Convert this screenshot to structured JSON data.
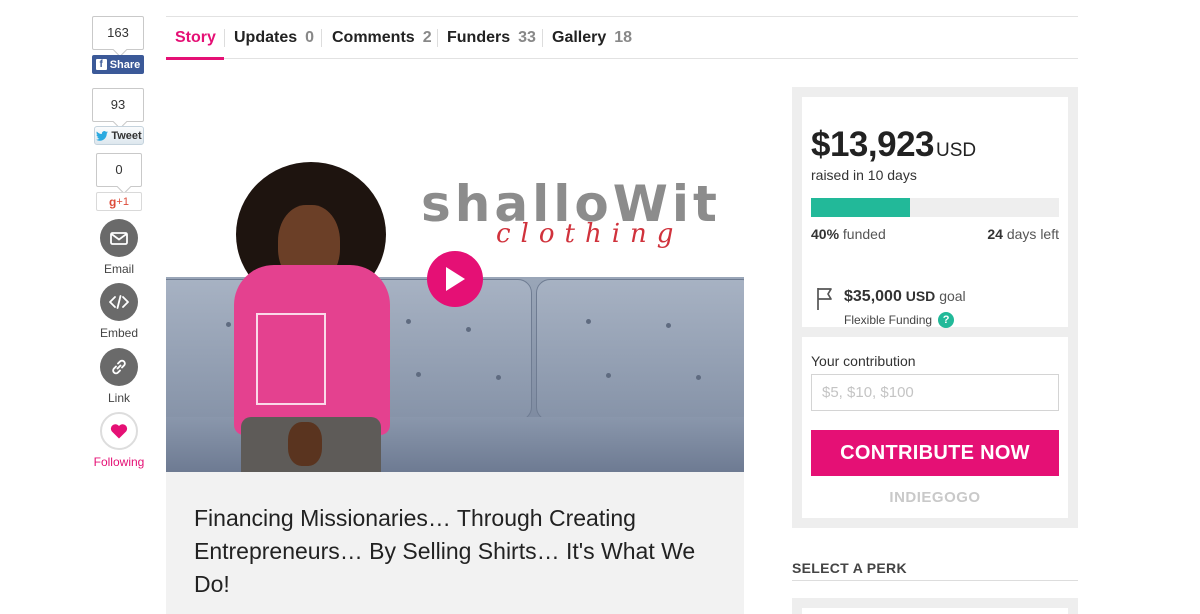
{
  "social": {
    "facebook": {
      "count": "163",
      "label": "Share"
    },
    "twitter": {
      "count": "93",
      "label": "Tweet"
    },
    "google": {
      "count": "0",
      "label": "+1"
    },
    "email": {
      "label": "Email",
      "icon": "envelope-icon"
    },
    "embed": {
      "label": "Embed",
      "icon": "code-icon"
    },
    "link": {
      "label": "Link",
      "icon": "link-icon"
    },
    "follow": {
      "label": "Following",
      "icon": "heart-icon",
      "color": "#e51075"
    }
  },
  "tabs": [
    {
      "label": "Story",
      "count": ""
    },
    {
      "label": "Updates",
      "count": "0"
    },
    {
      "label": "Comments",
      "count": "2"
    },
    {
      "label": "Funders",
      "count": "33"
    },
    {
      "label": "Gallery",
      "count": "18"
    }
  ],
  "video": {
    "brand_name": "shalloWit",
    "brand_sub": "clothing",
    "play_icon": "play-icon"
  },
  "campaign": {
    "title": "Financing Missionaries… Through Creating Entrepreneurs… By Selling Shirts… It's What We Do!"
  },
  "funding": {
    "amount": "$13,923",
    "currency": "USD",
    "raised_text": "raised in 10 days",
    "percent_funded": 40,
    "funded_pct_label": "40%",
    "funded_word": "funded",
    "days_left": "24",
    "days_left_word": "days left",
    "goal_amount": "$35,000",
    "goal_currency": "USD",
    "goal_word": "goal",
    "funding_type": "Flexible Funding",
    "help_icon": "?"
  },
  "contribution": {
    "label": "Your contribution",
    "placeholder": "$5, $10, $100",
    "button": "CONTRIBUTE NOW",
    "brand": "INDIEGOGO"
  },
  "perks": {
    "heading": "SELECT A PERK"
  },
  "colors": {
    "accent": "#e51075",
    "progress": "#22b999",
    "facebook": "#3b5998"
  }
}
